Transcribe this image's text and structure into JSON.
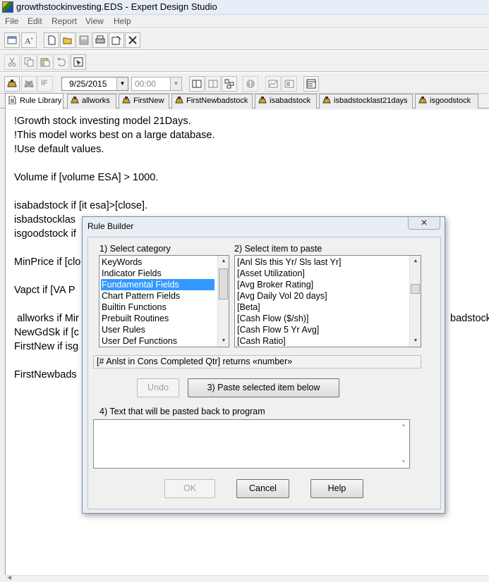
{
  "window": {
    "title": "growthstockinvesting.EDS - Expert Design Studio"
  },
  "menu": [
    "File",
    "Edit",
    "Report",
    "View",
    "Help"
  ],
  "toolbar3": {
    "date_value": "9/25/2015",
    "time_value": "00:00",
    "if_label": "IF"
  },
  "tabs": [
    {
      "label": "Rule Library",
      "active": true
    },
    {
      "label": "allworks"
    },
    {
      "label": "FirstNew"
    },
    {
      "label": "FirstNewbadstock"
    },
    {
      "label": "isabadstock"
    },
    {
      "label": "isbadstocklast21days"
    },
    {
      "label": "isgoodstock"
    }
  ],
  "editor": {
    "lines": [
      "!Growth stock investing model 21Days.",
      "!This model works best on a large database.",
      "!Use default values.",
      "",
      "Volume if [volume ESA] > 1000.",
      "",
      "isabadstock if [it esa]>[close].",
      "isbadstocklas",
      "isgoodstock if",
      "",
      "MinPrice if [clo",
      "",
      "Vapct if [VA P",
      "",
      " allworks if Mir",
      "NewGdSk if [c",
      "FirstNew if isg",
      "",
      "FirstNewbads"
    ],
    "overflow_right": "badstock"
  },
  "dialog": {
    "title": "Rule Builder",
    "close_glyph": "✕",
    "category_label": "1) Select category",
    "item_label": "2) Select item to paste",
    "categories": [
      {
        "label": "KeyWords"
      },
      {
        "label": "Indicator Fields"
      },
      {
        "label": "Fundamental Fields",
        "selected": true
      },
      {
        "label": "Chart Pattern Fields"
      },
      {
        "label": "Builtin Functions"
      },
      {
        "label": "Prebuilt Routines"
      },
      {
        "label": "User Rules"
      },
      {
        "label": "User Def Functions"
      }
    ],
    "items": [
      "[Anl Sls this Yr/ Sls last Yr]",
      "[Asset Utilization]",
      "[Avg Broker Rating]",
      "[Avg Daily Vol 20 days]",
      "[Beta]",
      "[Cash Flow ($/sh)]",
      "[Cash Flow 5 Yr Avg]",
      "[Cash Ratio]"
    ],
    "info_text": "[# Anlst in Cons Completed Qtr] returns «number»",
    "undo_label": "Undo",
    "paste_label": "3) Paste selected item below",
    "text_label": "4) Text that will be pasted back to program",
    "text_value": "",
    "ok_label": "OK",
    "cancel_label": "Cancel",
    "help_label": "Help"
  }
}
